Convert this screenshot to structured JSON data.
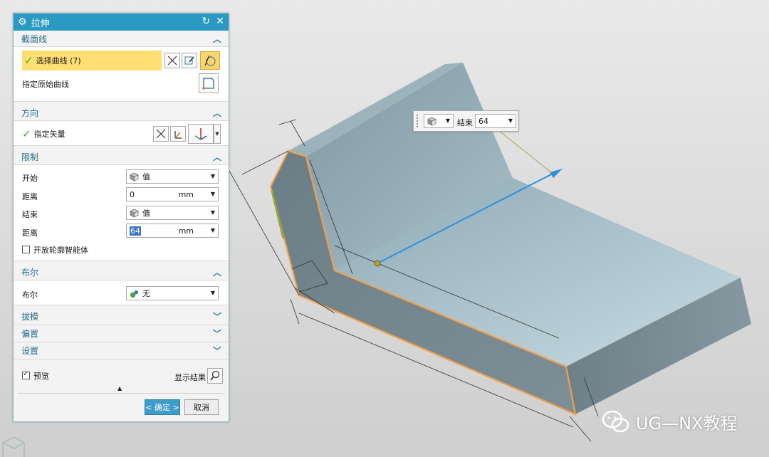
{
  "dialog": {
    "title": "拉伸",
    "sections": {
      "section": {
        "title": "截面线",
        "select_curve": "选择曲线 (7)",
        "specify_origin": "指定原始曲线"
      },
      "direction": {
        "title": "方向",
        "specify_vector": "指定矢量"
      },
      "limits": {
        "title": "限制",
        "start_label": "开始",
        "start_value": "值",
        "distance1_label": "距离",
        "distance1_value": "0",
        "distance1_unit": "mm",
        "end_label": "结束",
        "end_value": "值",
        "distance2_label": "距离",
        "distance2_value": "64",
        "distance2_unit": "mm",
        "open_profile": "开放轮廓智能体"
      },
      "boolean": {
        "title": "布尔",
        "label": "布尔",
        "value": "无"
      },
      "draft": {
        "title": "拔模"
      },
      "offset": {
        "title": "偏置"
      },
      "settings": {
        "title": "设置"
      }
    },
    "preview_label": "预览",
    "show_result_label": "显示结果",
    "ok_label": "< 确定 >",
    "cancel_label": "取消"
  },
  "floatbar": {
    "label": "结束",
    "value": "64"
  },
  "watermark": {
    "text": "UG—NX教程"
  },
  "colors": {
    "titlebar": "#2a9ac2",
    "highlight": "#ffde73",
    "edge": "#f4a04a",
    "vector": "#2d8fe0"
  }
}
